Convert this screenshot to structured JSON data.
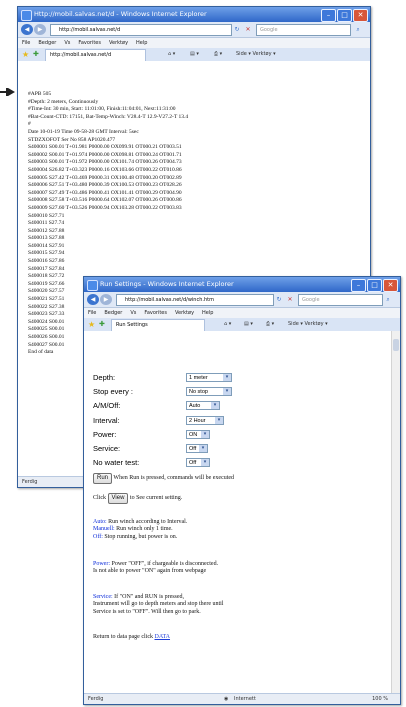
{
  "window1": {
    "title": "Http://mobil.salvas.net/d - Windows Internet Explorer",
    "url": "http://mobil.salvas.net/d",
    "search_placeholder": "Google",
    "menu": [
      "File",
      "Bedger",
      "Vs",
      "Favorites",
      "Verktøy",
      "Help"
    ],
    "tab_label": "http://mobil.salvas.net/d",
    "tools": "Side ▾  Verktøy ▾",
    "status": "Ferdig",
    "lines": [
      "#APB 505",
      "#Depth: 2 meters, Continuously",
      "#Time-Int: 30 min, Start: 11:01:00, Finish:11:04:01, Next:11:31:00",
      "#Bat-Count-CTD: 17151, Bat-Temp-Winch: V28.4-T 12.9-V27.2-T 13.4",
      "#",
      "Date 10-01-19 Time 09-58-28 GMT Interval: 5sec",
      "STDZXOFOT Ser No 858 AP1020.477",
      "S400001 S00.01 T+01.981 P0000.00 OX099.91 OT000.21 OT003.51",
      "S400002 S00.01 T+01.974 P0000.00 OX098.81 OT000.24 OT001.71",
      "S400003 S00.01 T+01.972 P0000.00 OX101.74 OT000.26 OT004.73",
      "S400004 S26.82 T+03.323 P0000.16 OX103.66 OT000.22 OT010.86",
      "S400005 S27.42 T+03.469 P0000.31 OX100.48 OT000.20 OT002.89",
      "S400006 S27.51 T+03.480 P0000.39 OX100.53 OT000.23 OT028.26",
      "S400007 S27.49 T+03.486 P0000.41 OX101.41 OT000.29 OT004.90",
      "S400008 S27.58 T+03.516 P0000.64 OX102.07 OT000.26 OT000.86",
      "S400009 S27.60 T+03.526 P0000.94 OX103.28 OT000.22 OT003.83",
      "S400010 S27.71",
      "S400011 S27.74",
      "S400012 S27.88",
      "S400013 S27.88",
      "S400014 S27.91",
      "S400015 S27.94",
      "S400016 S27.86",
      "S400017 S27.84",
      "S400018 S27.72",
      "S400019 S27.66",
      "S400020 S27.57",
      "S400021 S27.51",
      "S400022 S27.38",
      "S400023 S27.33",
      "S400024 S00.01",
      "S400025 S00.01",
      "S400026 S00.01",
      "S400027 S00.01",
      "End of data"
    ]
  },
  "window2": {
    "title": "Run Settings - Windows Internet Explorer",
    "url": "http://mobil.salvas.net/d/winch.htm",
    "search_placeholder": "Google",
    "menu": [
      "File",
      "Bedger",
      "Vs",
      "Favorites",
      "Verktøy",
      "Help"
    ],
    "tab_label": "Run Settings",
    "tools": "Side ▾  Verktøy ▾",
    "status_left": "Ferdig",
    "status_zone": "Internett",
    "status_zoom": "100 %",
    "settings": [
      {
        "label": "Depth:",
        "value": "1 meter"
      },
      {
        "label": "Stop every :",
        "value": "No stop"
      },
      {
        "label": "A/M/Off:",
        "value": "Auto"
      },
      {
        "label": "Interval:",
        "value": "2 Hour"
      },
      {
        "label": "Power:",
        "value": "ON"
      },
      {
        "label": "Service:",
        "value": "Off"
      },
      {
        "label": "No water test:",
        "value": "Off"
      }
    ],
    "run_button": "Run",
    "run_text": "When Run is pressed, commands will be executed",
    "click_text": "Click",
    "view_button": "View",
    "view_text": "to See current setting.",
    "auto_label": "Auto:",
    "auto_text": "Run winch according to Interval.",
    "manual_label": "Manuell:",
    "manual_text": "Run winch only 1 time.",
    "off_label": "Off:",
    "off_text": "Stop running, but power is on.",
    "power_label": "Power:",
    "power_text1": "Power \"OFF\", if chargeable is disconnected.",
    "power_text2": "Is not able to power \"ON\" again from webpage",
    "service_label": "Service:",
    "service_text1": "If \"ON\" and RUN is pressed,",
    "service_text2": "Instrument will go to depth meters and stop there until",
    "service_text3": "Service is set to \"OFF\". Will then go to park.",
    "return_text": "Return to data page click",
    "return_link": "DATA"
  }
}
